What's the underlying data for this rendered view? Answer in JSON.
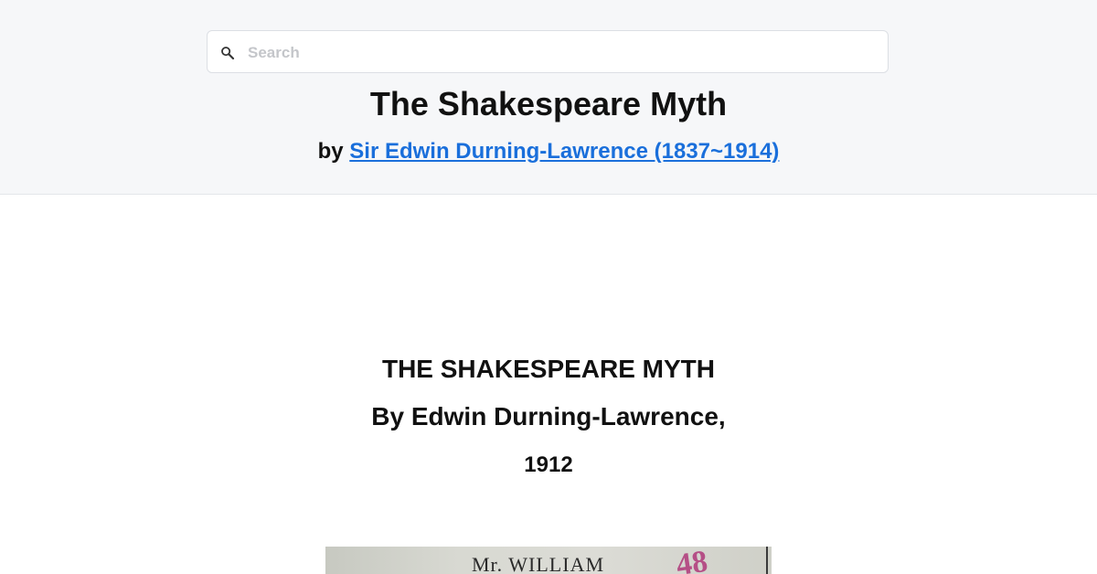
{
  "search": {
    "placeholder": "Search",
    "value": ""
  },
  "header": {
    "title": "The Shakespeare Myth",
    "by_prefix": "by ",
    "author_link": "Sir Edwin Durning-Lawrence (1837~1914)",
    "link_color": "#1a6fdb",
    "background": "#f6f7f9"
  },
  "content": {
    "book_title": "THE SHAKESPEARE MYTH",
    "book_author": "By Edwin Durning-Lawrence,",
    "book_year": "1912"
  },
  "scan": {
    "visible_text": "Mr. WILLIAM",
    "stamp_text": "48"
  }
}
